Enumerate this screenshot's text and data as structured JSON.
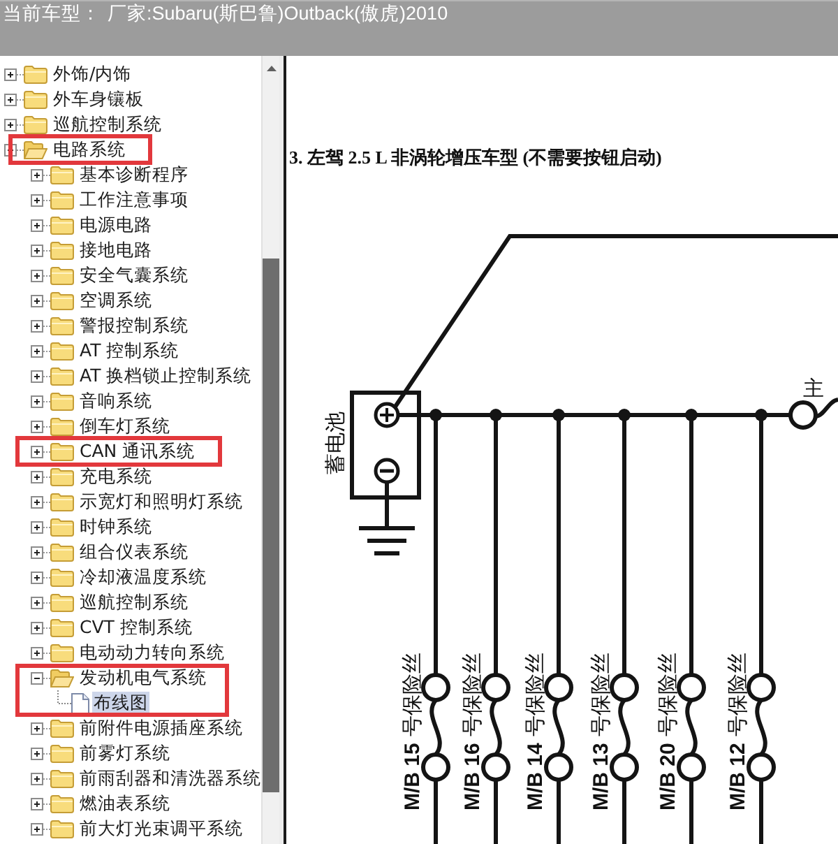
{
  "header": {
    "label": "当前车型：",
    "value": "厂家:Subaru(斯巴鲁)Outback(傲虎)2010"
  },
  "tree": {
    "items": [
      {
        "label": "外饰/内饰",
        "kind": "folder",
        "expanded": false,
        "selected": false,
        "annotated": false
      },
      {
        "label": "外车身镶板",
        "kind": "folder",
        "expanded": false,
        "selected": false,
        "annotated": false
      },
      {
        "label": "巡航控制系统",
        "kind": "folder",
        "expanded": false,
        "selected": false,
        "annotated": false
      },
      {
        "label": "电路系统",
        "kind": "folder",
        "expanded": true,
        "selected": false,
        "annotated": true,
        "children": [
          {
            "label": "基本诊断程序",
            "kind": "folder",
            "expanded": false,
            "selected": false,
            "annotated": false
          },
          {
            "label": "工作注意事项",
            "kind": "folder",
            "expanded": false,
            "selected": false,
            "annotated": false
          },
          {
            "label": "电源电路",
            "kind": "folder",
            "expanded": false,
            "selected": false,
            "annotated": false
          },
          {
            "label": "接地电路",
            "kind": "folder",
            "expanded": false,
            "selected": false,
            "annotated": false
          },
          {
            "label": "安全气囊系统",
            "kind": "folder",
            "expanded": false,
            "selected": false,
            "annotated": false
          },
          {
            "label": "空调系统",
            "kind": "folder",
            "expanded": false,
            "selected": false,
            "annotated": false
          },
          {
            "label": "警报控制系统",
            "kind": "folder",
            "expanded": false,
            "selected": false,
            "annotated": false
          },
          {
            "label": "AT 控制系统",
            "kind": "folder",
            "expanded": false,
            "selected": false,
            "annotated": false
          },
          {
            "label": "AT 换档锁止控制系统",
            "kind": "folder",
            "expanded": false,
            "selected": false,
            "annotated": false
          },
          {
            "label": "音响系统",
            "kind": "folder",
            "expanded": false,
            "selected": false,
            "annotated": false
          },
          {
            "label": "倒车灯系统",
            "kind": "folder",
            "expanded": false,
            "selected": false,
            "annotated": false
          },
          {
            "label": "CAN 通讯系统",
            "kind": "folder",
            "expanded": false,
            "selected": false,
            "annotated": true
          },
          {
            "label": "充电系统",
            "kind": "folder",
            "expanded": false,
            "selected": false,
            "annotated": false
          },
          {
            "label": "示宽灯和照明灯系统",
            "kind": "folder",
            "expanded": false,
            "selected": false,
            "annotated": false
          },
          {
            "label": "时钟系统",
            "kind": "folder",
            "expanded": false,
            "selected": false,
            "annotated": false
          },
          {
            "label": "组合仪表系统",
            "kind": "folder",
            "expanded": false,
            "selected": false,
            "annotated": false
          },
          {
            "label": "冷却液温度系统",
            "kind": "folder",
            "expanded": false,
            "selected": false,
            "annotated": false
          },
          {
            "label": "巡航控制系统",
            "kind": "folder",
            "expanded": false,
            "selected": false,
            "annotated": false
          },
          {
            "label": "CVT 控制系统",
            "kind": "folder",
            "expanded": false,
            "selected": false,
            "annotated": false
          },
          {
            "label": "电动动力转向系统",
            "kind": "folder",
            "expanded": false,
            "selected": false,
            "annotated": false
          },
          {
            "label": "发动机电气系统",
            "kind": "folder",
            "expanded": true,
            "selected": false,
            "annotated": true,
            "children": [
              {
                "label": "布线图",
                "kind": "document",
                "selected": true,
                "annotated": true
              }
            ]
          },
          {
            "label": "前附件电源插座系统",
            "kind": "folder",
            "expanded": false,
            "selected": false,
            "annotated": false
          },
          {
            "label": "前雾灯系统",
            "kind": "folder",
            "expanded": false,
            "selected": false,
            "annotated": false
          },
          {
            "label": "前雨刮器和清洗器系统",
            "kind": "folder",
            "expanded": false,
            "selected": false,
            "annotated": false
          },
          {
            "label": "燃油表系统",
            "kind": "folder",
            "expanded": false,
            "selected": false,
            "annotated": false
          },
          {
            "label": "前大灯光束调平系统",
            "kind": "folder",
            "expanded": false,
            "selected": false,
            "annotated": false
          }
        ]
      }
    ]
  },
  "diagram": {
    "title": "3. 左驾 2.5 L 非涡轮增压车型 (不需要按钮启动)",
    "battery_label": "蓄电池",
    "main_label": "主",
    "fuses": [
      {
        "code": "M/B 15",
        "name": "号保险丝"
      },
      {
        "code": "M/B 16",
        "name": "号保险丝"
      },
      {
        "code": "M/B 14",
        "name": "号保险丝"
      },
      {
        "code": "M/B 13",
        "name": "号保险丝"
      },
      {
        "code": "M/B 20",
        "name": "号保险丝"
      },
      {
        "code": "M/B 12",
        "name": "号保险丝"
      }
    ]
  }
}
